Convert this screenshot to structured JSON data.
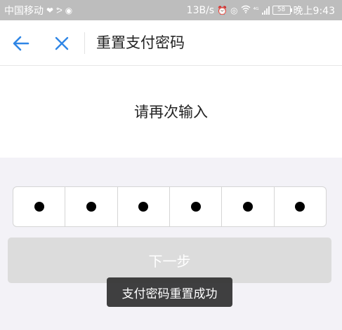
{
  "status_bar": {
    "carrier": "中国移动",
    "net_speed": "13B/s",
    "network_type": "⁴ᴳ",
    "battery": "58",
    "time": "晚上9:43",
    "icons": [
      "heart-icon",
      "fitness-icon",
      "record-icon",
      "alarm-icon",
      "eye-icon",
      "wifi-icon",
      "signal-icon",
      "battery-icon"
    ]
  },
  "header": {
    "title": "重置支付密码",
    "back_icon": "arrow-left-icon",
    "close_icon": "close-icon",
    "accent_color": "#2f86e6"
  },
  "prompt": {
    "text": "请再次输入"
  },
  "pin": {
    "length": 6,
    "filled": 6
  },
  "next_button": {
    "label": "下一步",
    "enabled": false
  },
  "toast": {
    "message": "支付密码重置成功"
  }
}
